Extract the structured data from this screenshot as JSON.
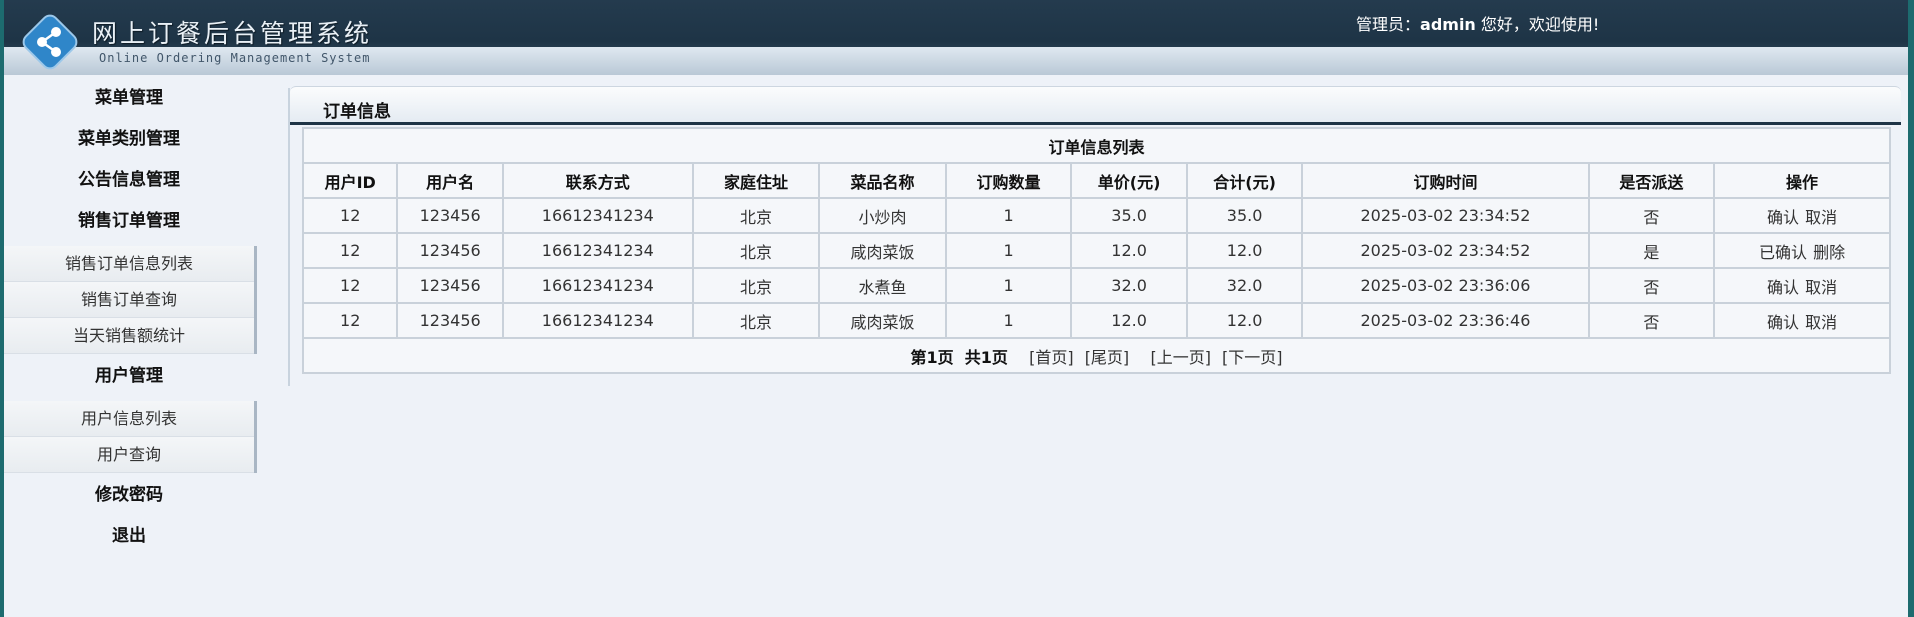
{
  "header": {
    "title": "网上订餐后台管理系统",
    "subtitle": "Online Ordering Management System",
    "welcome_prefix": "管理员：",
    "welcome_user": "admin",
    "welcome_suffix": " 您好，欢迎使用!"
  },
  "sidebar": {
    "menu_mgmt": "菜单管理",
    "menu_category_mgmt": "菜单类别管理",
    "notice_mgmt": "公告信息管理",
    "sales_order_mgmt": "销售订单管理",
    "sales_sub": [
      "销售订单信息列表",
      "销售订单查询",
      "当天销售额统计"
    ],
    "user_mgmt": "用户管理",
    "user_sub": [
      "用户信息列表",
      "用户查询"
    ],
    "change_password": "修改密码",
    "logout": "退出"
  },
  "panel": {
    "title": "订单信息",
    "table_caption": "订单信息列表"
  },
  "table": {
    "columns": [
      "用户ID",
      "用户名",
      "联系方式",
      "家庭住址",
      "菜品名称",
      "订购数量",
      "单价(元)",
      "合计(元)",
      "订购时间",
      "是否派送",
      "操作"
    ],
    "rows": [
      {
        "user_id": "12",
        "username": "123456",
        "phone": "16612341234",
        "address": "北京",
        "dish": "小炒肉",
        "qty": "1",
        "price": "35.0",
        "total": "35.0",
        "time": "2025-03-02 23:34:52",
        "delivered": "否",
        "actions": [
          "确认",
          "取消"
        ]
      },
      {
        "user_id": "12",
        "username": "123456",
        "phone": "16612341234",
        "address": "北京",
        "dish": "咸肉菜饭",
        "qty": "1",
        "price": "12.0",
        "total": "12.0",
        "time": "2025-03-02 23:34:52",
        "delivered": "是",
        "actions": [
          "已确认",
          "删除"
        ]
      },
      {
        "user_id": "12",
        "username": "123456",
        "phone": "16612341234",
        "address": "北京",
        "dish": "水煮鱼",
        "qty": "1",
        "price": "32.0",
        "total": "32.0",
        "time": "2025-03-02 23:36:06",
        "delivered": "否",
        "actions": [
          "确认",
          "取消"
        ]
      },
      {
        "user_id": "12",
        "username": "123456",
        "phone": "16612341234",
        "address": "北京",
        "dish": "咸肉菜饭",
        "qty": "1",
        "price": "12.0",
        "total": "12.0",
        "time": "2025-03-02 23:36:46",
        "delivered": "否",
        "actions": [
          "确认",
          "取消"
        ]
      }
    ]
  },
  "pager": {
    "current": "第1页",
    "total": "共1页",
    "first": "[首页]",
    "last": "[尾页]",
    "prev": "[上一页]",
    "next": "[下一页]"
  },
  "colors": {
    "header_dark": "#1e3446",
    "background": "#eef2f8",
    "border": "#c9d1da"
  }
}
